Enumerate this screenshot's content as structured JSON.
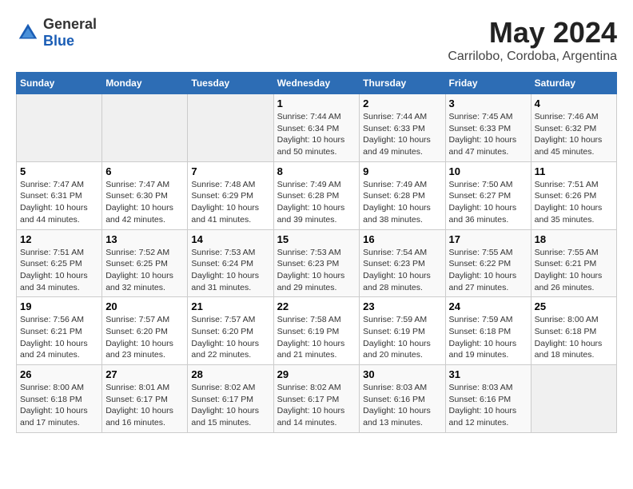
{
  "logo": {
    "general": "General",
    "blue": "Blue"
  },
  "title": {
    "month_year": "May 2024",
    "location": "Carrilobo, Cordoba, Argentina"
  },
  "weekdays": [
    "Sunday",
    "Monday",
    "Tuesday",
    "Wednesday",
    "Thursday",
    "Friday",
    "Saturday"
  ],
  "weeks": [
    [
      {
        "day": "",
        "empty": true
      },
      {
        "day": "",
        "empty": true
      },
      {
        "day": "",
        "empty": true
      },
      {
        "day": "1",
        "sunrise": "7:44 AM",
        "sunset": "6:34 PM",
        "daylight": "10 hours and 50 minutes."
      },
      {
        "day": "2",
        "sunrise": "7:44 AM",
        "sunset": "6:33 PM",
        "daylight": "10 hours and 49 minutes."
      },
      {
        "day": "3",
        "sunrise": "7:45 AM",
        "sunset": "6:33 PM",
        "daylight": "10 hours and 47 minutes."
      },
      {
        "day": "4",
        "sunrise": "7:46 AM",
        "sunset": "6:32 PM",
        "daylight": "10 hours and 45 minutes."
      }
    ],
    [
      {
        "day": "5",
        "sunrise": "7:47 AM",
        "sunset": "6:31 PM",
        "daylight": "10 hours and 44 minutes."
      },
      {
        "day": "6",
        "sunrise": "7:47 AM",
        "sunset": "6:30 PM",
        "daylight": "10 hours and 42 minutes."
      },
      {
        "day": "7",
        "sunrise": "7:48 AM",
        "sunset": "6:29 PM",
        "daylight": "10 hours and 41 minutes."
      },
      {
        "day": "8",
        "sunrise": "7:49 AM",
        "sunset": "6:28 PM",
        "daylight": "10 hours and 39 minutes."
      },
      {
        "day": "9",
        "sunrise": "7:49 AM",
        "sunset": "6:28 PM",
        "daylight": "10 hours and 38 minutes."
      },
      {
        "day": "10",
        "sunrise": "7:50 AM",
        "sunset": "6:27 PM",
        "daylight": "10 hours and 36 minutes."
      },
      {
        "day": "11",
        "sunrise": "7:51 AM",
        "sunset": "6:26 PM",
        "daylight": "10 hours and 35 minutes."
      }
    ],
    [
      {
        "day": "12",
        "sunrise": "7:51 AM",
        "sunset": "6:25 PM",
        "daylight": "10 hours and 34 minutes."
      },
      {
        "day": "13",
        "sunrise": "7:52 AM",
        "sunset": "6:25 PM",
        "daylight": "10 hours and 32 minutes."
      },
      {
        "day": "14",
        "sunrise": "7:53 AM",
        "sunset": "6:24 PM",
        "daylight": "10 hours and 31 minutes."
      },
      {
        "day": "15",
        "sunrise": "7:53 AM",
        "sunset": "6:23 PM",
        "daylight": "10 hours and 29 minutes."
      },
      {
        "day": "16",
        "sunrise": "7:54 AM",
        "sunset": "6:23 PM",
        "daylight": "10 hours and 28 minutes."
      },
      {
        "day": "17",
        "sunrise": "7:55 AM",
        "sunset": "6:22 PM",
        "daylight": "10 hours and 27 minutes."
      },
      {
        "day": "18",
        "sunrise": "7:55 AM",
        "sunset": "6:21 PM",
        "daylight": "10 hours and 26 minutes."
      }
    ],
    [
      {
        "day": "19",
        "sunrise": "7:56 AM",
        "sunset": "6:21 PM",
        "daylight": "10 hours and 24 minutes."
      },
      {
        "day": "20",
        "sunrise": "7:57 AM",
        "sunset": "6:20 PM",
        "daylight": "10 hours and 23 minutes."
      },
      {
        "day": "21",
        "sunrise": "7:57 AM",
        "sunset": "6:20 PM",
        "daylight": "10 hours and 22 minutes."
      },
      {
        "day": "22",
        "sunrise": "7:58 AM",
        "sunset": "6:19 PM",
        "daylight": "10 hours and 21 minutes."
      },
      {
        "day": "23",
        "sunrise": "7:59 AM",
        "sunset": "6:19 PM",
        "daylight": "10 hours and 20 minutes."
      },
      {
        "day": "24",
        "sunrise": "7:59 AM",
        "sunset": "6:18 PM",
        "daylight": "10 hours and 19 minutes."
      },
      {
        "day": "25",
        "sunrise": "8:00 AM",
        "sunset": "6:18 PM",
        "daylight": "10 hours and 18 minutes."
      }
    ],
    [
      {
        "day": "26",
        "sunrise": "8:00 AM",
        "sunset": "6:18 PM",
        "daylight": "10 hours and 17 minutes."
      },
      {
        "day": "27",
        "sunrise": "8:01 AM",
        "sunset": "6:17 PM",
        "daylight": "10 hours and 16 minutes."
      },
      {
        "day": "28",
        "sunrise": "8:02 AM",
        "sunset": "6:17 PM",
        "daylight": "10 hours and 15 minutes."
      },
      {
        "day": "29",
        "sunrise": "8:02 AM",
        "sunset": "6:17 PM",
        "daylight": "10 hours and 14 minutes."
      },
      {
        "day": "30",
        "sunrise": "8:03 AM",
        "sunset": "6:16 PM",
        "daylight": "10 hours and 13 minutes."
      },
      {
        "day": "31",
        "sunrise": "8:03 AM",
        "sunset": "6:16 PM",
        "daylight": "10 hours and 12 minutes."
      },
      {
        "day": "",
        "empty": true
      }
    ]
  ]
}
